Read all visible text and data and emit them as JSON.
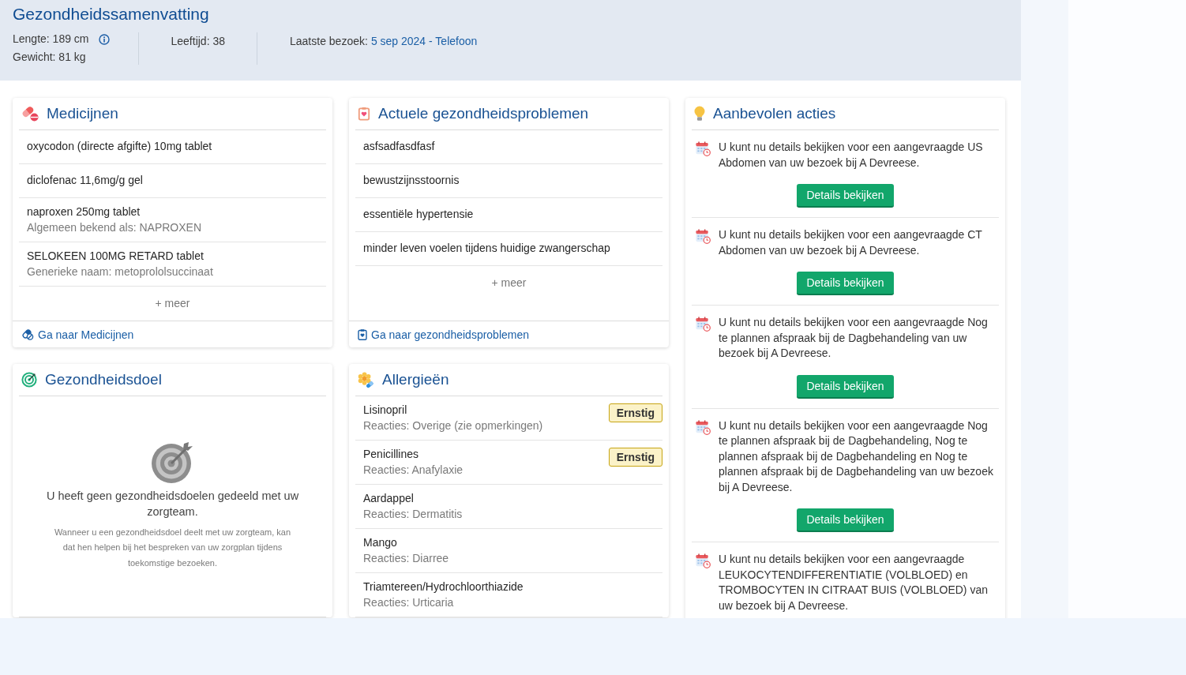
{
  "summary": {
    "title": "Gezondheidssamenvatting",
    "length": "Lengte: 189 cm",
    "weight": "Gewicht: 81 kg",
    "age": "Leeftijd: 38",
    "last_visit_label": "Laatste bezoek:",
    "last_visit_link": "5 sep 2024 - Telefoon"
  },
  "medicines": {
    "title": "Medicijnen",
    "items": [
      {
        "name": "oxycodon (directe afgifte) 10mg tablet"
      },
      {
        "name": "diclofenac 11,6mg/g gel"
      },
      {
        "name": "naproxen 250mg tablet",
        "note": "Algemeen bekend als: NAPROXEN"
      },
      {
        "name": "SELOKEEN 100MG RETARD tablet",
        "note": "Generieke naam: metoprololsuccinaat"
      }
    ],
    "more": "+ meer",
    "footer_link": "Ga naar Medicijnen"
  },
  "problems": {
    "title": "Actuele gezondheidsproblemen",
    "items": [
      "asfsadfasdfasf",
      "bewustzijnsstoornis",
      "essentiële hypertensie",
      "minder leven voelen tijdens huidige zwangerschap"
    ],
    "more": "+ meer",
    "footer_link": "Ga naar gezondheidsproblemen"
  },
  "health_goal": {
    "title": "Gezondheidsdoel",
    "empty_message": "U heeft geen gezondheidsdoelen gedeeld met uw zorgteam.",
    "empty_hint": "Wanneer u een gezondheidsdoel deelt met uw zorgteam, kan dat hen helpen bij het bespreken van uw zorgplan tijdens toekomstige bezoeken."
  },
  "allergies": {
    "title": "Allergieën",
    "items": [
      {
        "name": "Lisinopril",
        "reactions": "Reacties: Overige (zie opmerkingen)",
        "severity": "Ernstig"
      },
      {
        "name": "Penicillines",
        "reactions": "Reacties: Anafylaxie",
        "severity": "Ernstig"
      },
      {
        "name": "Aardappel",
        "reactions": "Reacties: Dermatitis"
      },
      {
        "name": "Mango",
        "reactions": "Reacties: Diarree"
      },
      {
        "name": "Triamtereen/Hydrochloorthiazide",
        "reactions": "Reacties: Urticaria"
      }
    ]
  },
  "recommended_actions": {
    "title": "Aanbevolen acties",
    "items": [
      {
        "text": "U kunt nu details bekijken voor een aangevraagde US Abdomen van uw bezoek bij A Devreese.",
        "button": "Details bekijken"
      },
      {
        "text": "U kunt nu details bekijken voor een aangevraagde CT Abdomen van uw bezoek bij A Devreese.",
        "button": "Details bekijken"
      },
      {
        "text": "U kunt nu details bekijken voor een aangevraagde Nog te plannen afspraak bij de Dagbehandeling van uw bezoek bij A Devreese.",
        "button": "Details bekijken"
      },
      {
        "text": "U kunt nu details bekijken voor een aangevraagde Nog te plannen afspraak bij de Dagbehandeling, Nog te plannen afspraak bij de Dagbehandeling en Nog te plannen afspraak bij de Dagbehandeling van uw bezoek bij A Devreese.",
        "button": "Details bekijken"
      },
      {
        "text": "U kunt nu details bekijken voor een aangevraagde LEUKOCYTENDIFFERENTIATIE (VOLBLOED) en TROMBOCYTEN IN CITRAAT BUIS (VOLBLOED) van uw bezoek bij A Devreese."
      }
    ]
  }
}
